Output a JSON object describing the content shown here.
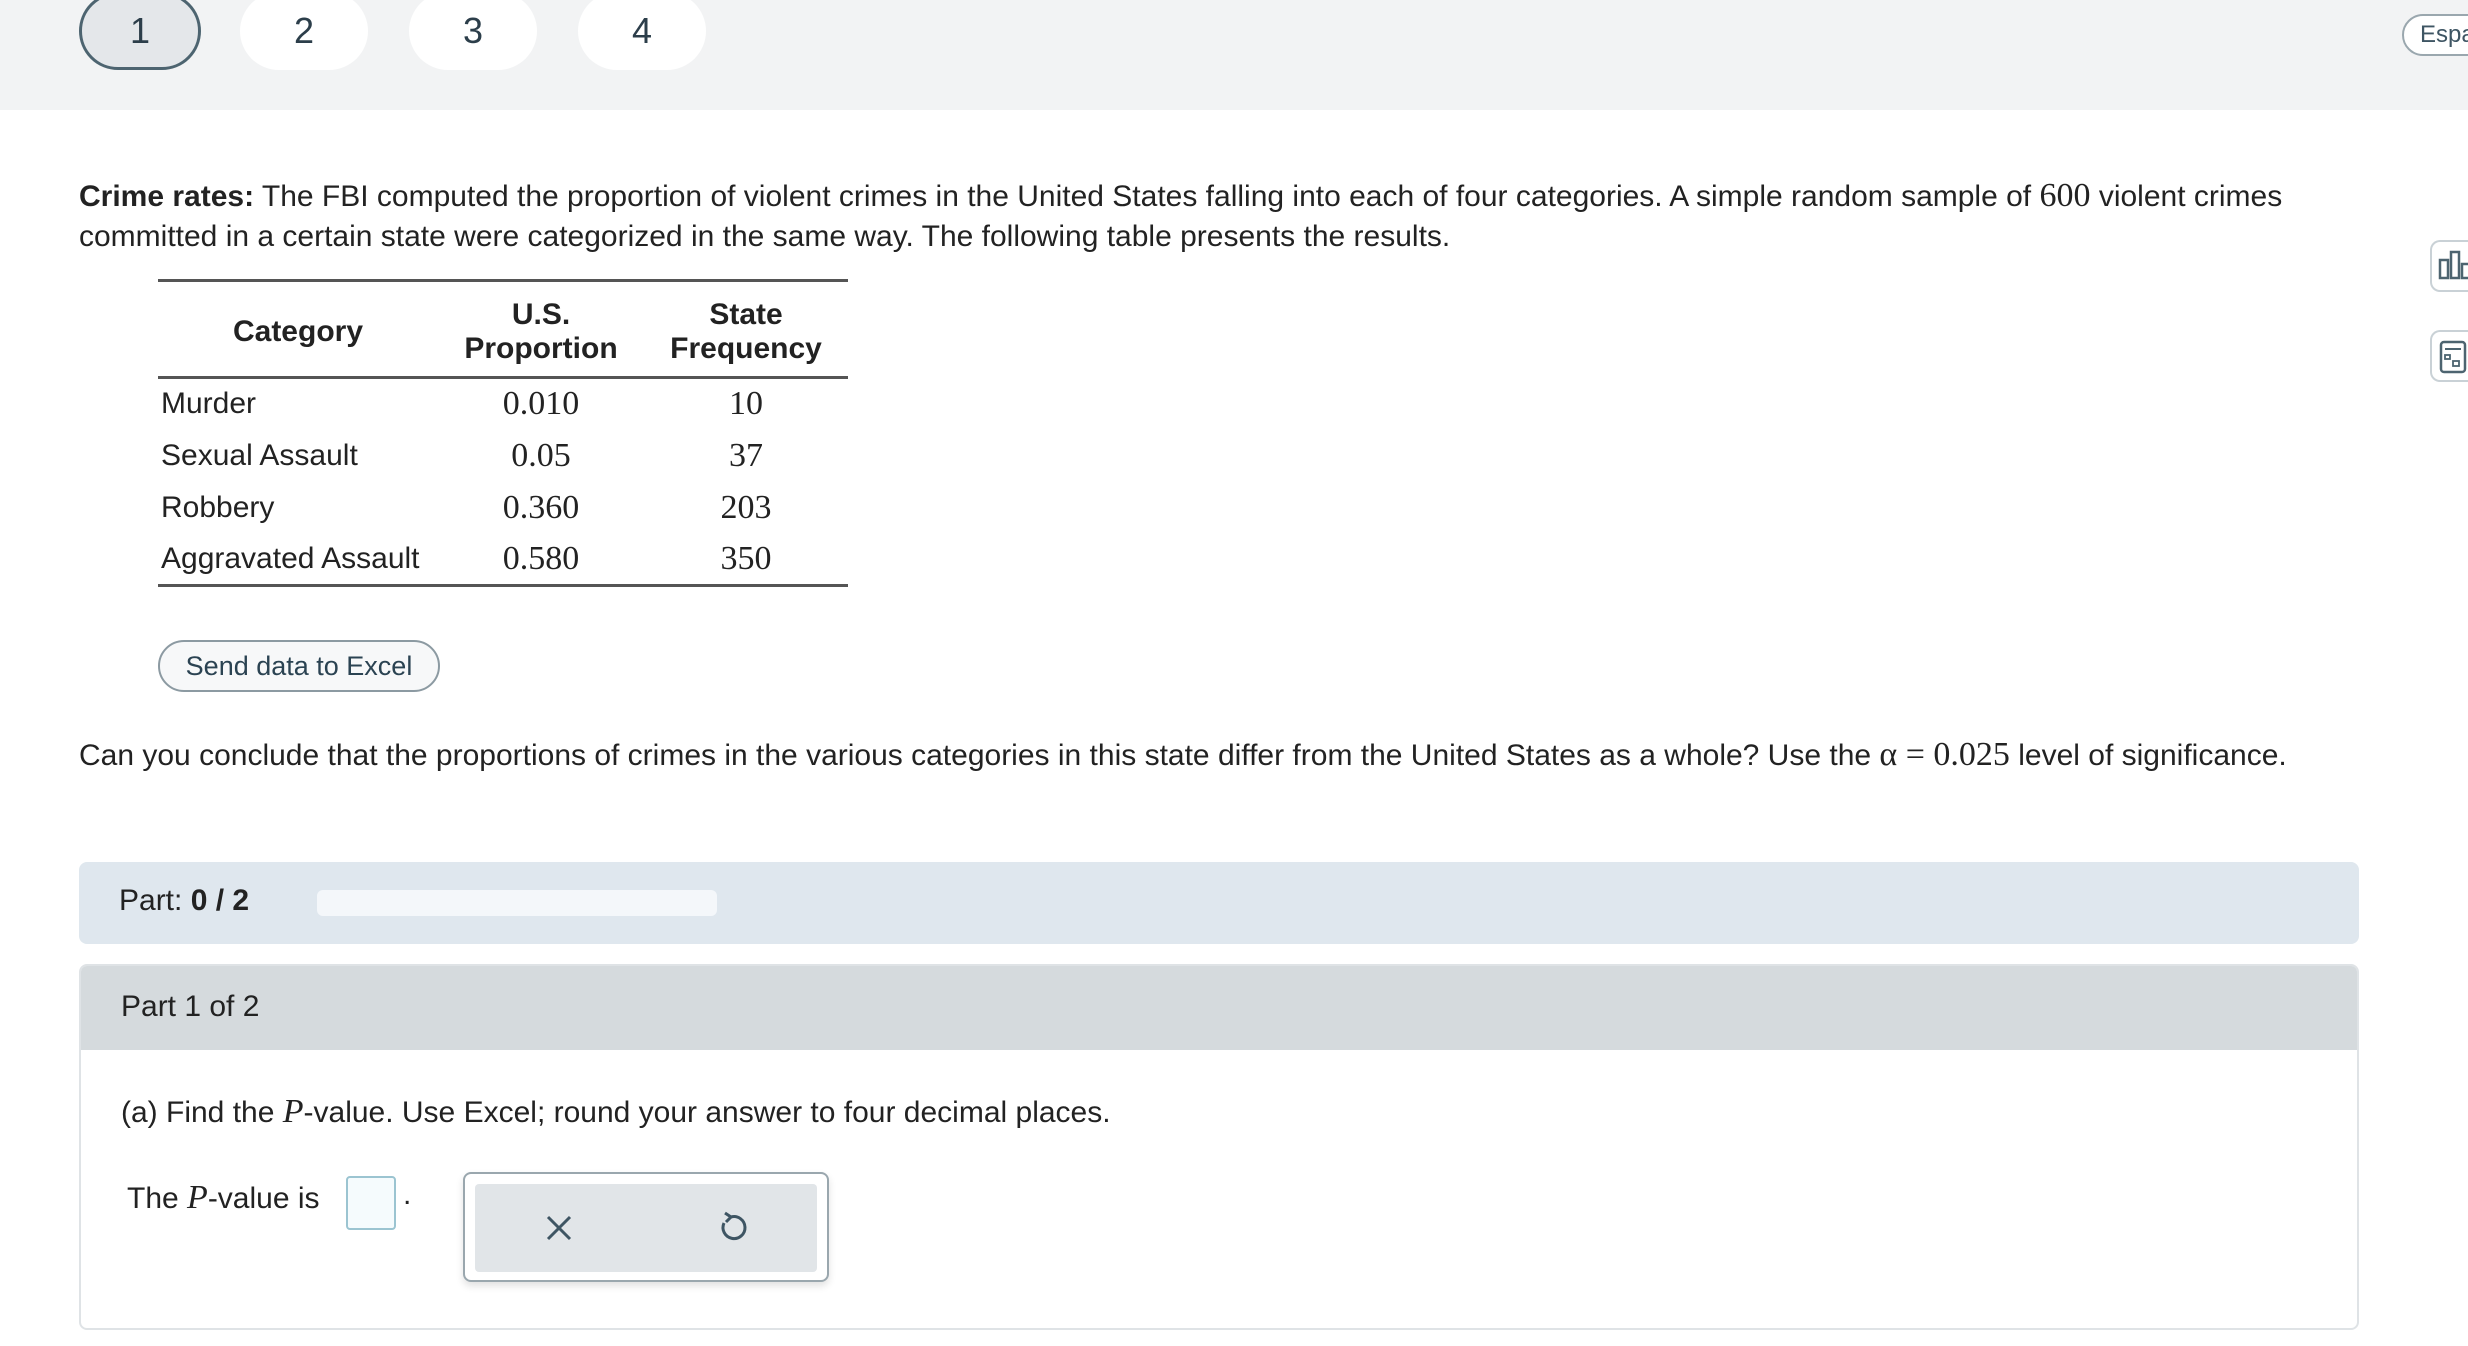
{
  "nav": {
    "questions": [
      "1",
      "2",
      "3",
      "4"
    ],
    "language": "Espa"
  },
  "problem": {
    "lead": "Crime rates:",
    "text_a": " The FBI computed the proportion of violent crimes in the United States falling into each of four categories. A simple random sample of ",
    "sample_size": "600",
    "text_b": " violent crimes committed in a certain state were categorized in the same way. The following table presents the results."
  },
  "table": {
    "headers": {
      "category": "Category",
      "proportion_l1": "U.S.",
      "proportion_l2": "Proportion",
      "frequency_l1": "State",
      "frequency_l2": "Frequency"
    },
    "rows": [
      {
        "category": "Murder",
        "proportion": "0.010",
        "frequency": "10"
      },
      {
        "category": "Sexual Assault",
        "proportion": "0.05",
        "frequency": "37"
      },
      {
        "category": "Robbery",
        "proportion": "0.360",
        "frequency": "203"
      },
      {
        "category": "Aggravated Assault",
        "proportion": "0.580",
        "frequency": "350"
      }
    ]
  },
  "excel_button": "Send data to Excel",
  "question": {
    "text_a": "Can you conclude that the proportions of crimes in the various categories in this state differ from the United States as a whole? Use the ",
    "alpha": "α = 0.025",
    "text_b": " level of significance."
  },
  "progress": {
    "label": "Part:",
    "value": "0 / 2",
    "fraction": 0
  },
  "part": {
    "title": "Part 1 of 2",
    "prompt_a": "(a) Find the ",
    "prompt_var": "P",
    "prompt_b": "-value. Use Excel; round your answer to four decimal places.",
    "answer_a": "The ",
    "answer_var": "P",
    "answer_b": "-value is",
    "answer_value": ""
  },
  "icons": {
    "clear": "close-icon",
    "undo": "undo-icon",
    "chart": "bar-chart-icon",
    "calculator": "calculator-icon"
  }
}
